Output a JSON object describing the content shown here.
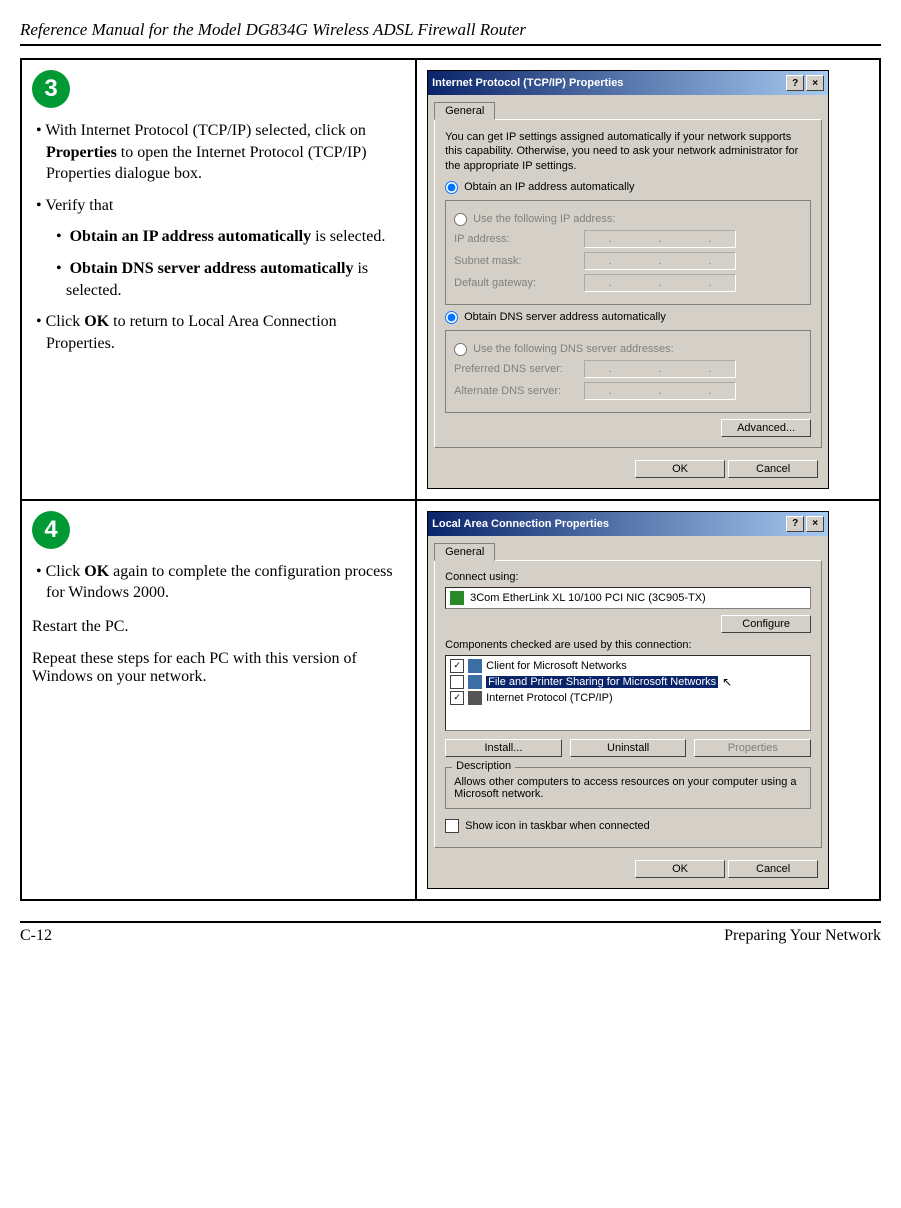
{
  "doc": {
    "header": "Reference Manual for the Model DG834G Wireless ADSL Firewall Router",
    "footer_left": "C-12",
    "footer_right": "Preparing Your Network"
  },
  "step3": {
    "num": "3",
    "l1a": "• With Internet Protocol (TCP/IP) selected, click on ",
    "l1b": "Properties",
    "l1c": " to open the Internet Protocol (TCP/IP) Properties dialogue box.",
    "l2": "• Verify that",
    "l3a": "•",
    "l3b": "Obtain an IP address automatically",
    "l3c": " is selected.",
    "l4a": "•",
    "l4b": "Obtain DNS server address automatically",
    "l4c": " is selected.",
    "l5a": "• Click ",
    "l5b": "OK",
    "l5c": " to return to Local Area Connection Properties."
  },
  "tcp": {
    "title": "Internet Protocol (TCP/IP) Properties",
    "tab": "General",
    "intro": "You can get IP settings assigned automatically if your network supports this capability. Otherwise, you need to ask your network administrator for the appropriate IP settings.",
    "r_ip_auto": "Obtain an IP address automatically",
    "r_ip_man": "Use the following IP address:",
    "f_ip": "IP address:",
    "f_mask": "Subnet mask:",
    "f_gw": "Default gateway:",
    "r_dns_auto": "Obtain DNS server address automatically",
    "r_dns_man": "Use the following DNS server addresses:",
    "f_dns1": "Preferred DNS server:",
    "f_dns2": "Alternate DNS server:",
    "btn_adv": "Advanced...",
    "btn_ok": "OK",
    "btn_cancel": "Cancel"
  },
  "step4": {
    "num": "4",
    "l1a": "• Click ",
    "l1b": "OK",
    "l1c": " again to complete the configuration process for Windows 2000.",
    "p1": "Restart the PC.",
    "p2": "Repeat these steps for each PC with this version of Windows on your network."
  },
  "lan": {
    "title": "Local Area Connection Properties",
    "tab": "General",
    "connect_label": "Connect using:",
    "nic": "3Com EtherLink XL 10/100 PCI NIC (3C905-TX)",
    "btn_conf": "Configure",
    "comp_label": "Components checked are used by this connection:",
    "c1": "Client for Microsoft Networks",
    "c2": "File and Printer Sharing for Microsoft Networks",
    "c3": "Internet Protocol (TCP/IP)",
    "btn_install": "Install...",
    "btn_uninstall": "Uninstall",
    "btn_props": "Properties",
    "desc_head": "Description",
    "desc_body": "Allows other computers to access resources on your computer using a Microsoft network.",
    "showicon": "Show icon in taskbar when connected",
    "btn_ok": "OK",
    "btn_cancel": "Cancel"
  }
}
